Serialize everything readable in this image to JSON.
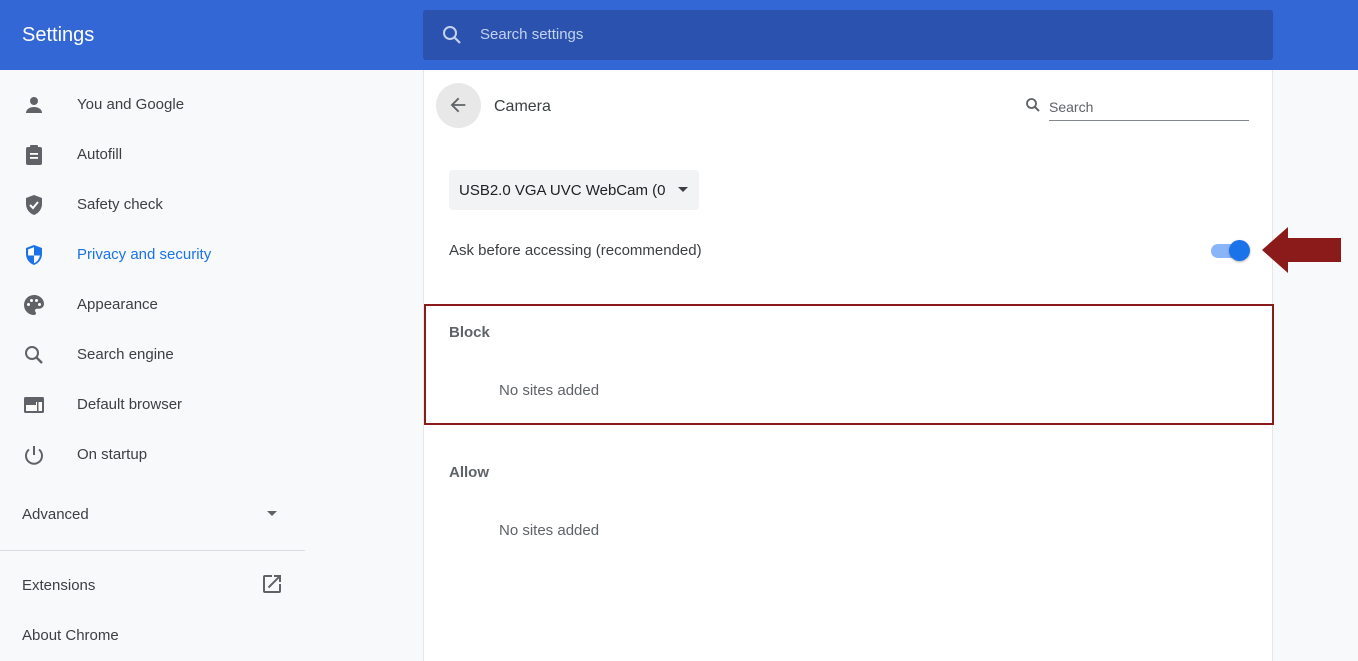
{
  "header": {
    "title": "Settings",
    "search_placeholder": "Search settings"
  },
  "sidebar": {
    "items": [
      {
        "label": "You and Google",
        "icon": "person-icon"
      },
      {
        "label": "Autofill",
        "icon": "clipboard-icon"
      },
      {
        "label": "Safety check",
        "icon": "shield-check-icon"
      },
      {
        "label": "Privacy and security",
        "icon": "shield-icon",
        "active": true
      },
      {
        "label": "Appearance",
        "icon": "palette-icon"
      },
      {
        "label": "Search engine",
        "icon": "search-icon"
      },
      {
        "label": "Default browser",
        "icon": "browser-icon"
      },
      {
        "label": "On startup",
        "icon": "power-icon"
      }
    ],
    "advanced_label": "Advanced",
    "extensions_label": "Extensions",
    "about_label": "About Chrome"
  },
  "main": {
    "title": "Camera",
    "search_placeholder": "Search",
    "device_selected": "USB2.0 VGA UVC WebCam (0",
    "ask_label": "Ask before accessing (recommended)",
    "ask_enabled": true,
    "block_title": "Block",
    "block_empty": "No sites added",
    "allow_title": "Allow",
    "allow_empty": "No sites added"
  },
  "colors": {
    "header_bg": "#3367d6",
    "search_bg": "#2a52ae",
    "accent": "#1a73e8",
    "annotation": "#8b1a1a"
  }
}
